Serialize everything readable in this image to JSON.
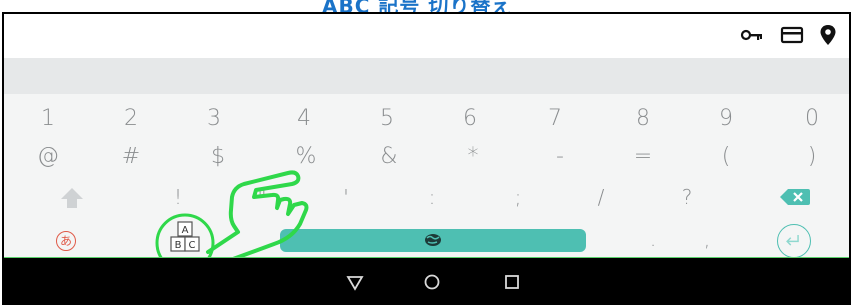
{
  "banner": {
    "title": "ABC 記号 切り替え"
  },
  "app_bar": {
    "icons": [
      "key-icon",
      "card-icon",
      "location-pin-icon"
    ]
  },
  "keyboard": {
    "row1": [
      "1",
      "2",
      "3",
      "4",
      "5",
      "6",
      "7",
      "8",
      "9",
      "0"
    ],
    "row2": [
      "@",
      "#",
      "$",
      "%",
      "&",
      "*",
      "-",
      "=",
      "(",
      ")"
    ],
    "row3": [
      "!",
      "\"",
      "'",
      ":",
      ";",
      "/",
      "?"
    ],
    "row4": {
      "kana_label": "あ",
      "period": ".",
      "comma": ","
    },
    "colors": {
      "accent": "#4ebfb2",
      "key_text": "#8a8d8f",
      "kana": "#e05a48",
      "background": "#f4f5f5"
    }
  },
  "overlay": {
    "highlight_color": "#2fd84a"
  },
  "nav": {
    "buttons": [
      "back-triangle-icon",
      "home-circle-icon",
      "recents-square-icon"
    ]
  }
}
